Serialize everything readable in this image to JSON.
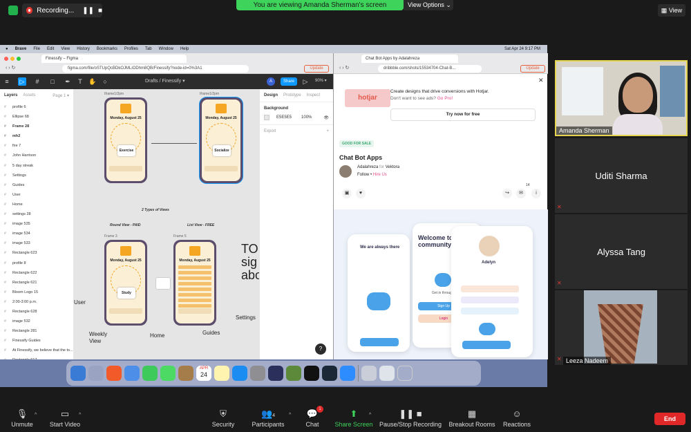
{
  "zoom": {
    "recording_label": "Recording...",
    "viewing_banner": "You are viewing Amanda Sherman's screen",
    "view_options": "View Options",
    "view_button": "View",
    "toolbar": {
      "unmute": "Unmute",
      "start_video": "Start Video",
      "security": "Security",
      "participants": "Participants",
      "participants_count": "4",
      "chat": "Chat",
      "chat_badge": "1",
      "share_screen": "Share Screen",
      "pause_stop": "Pause/Stop Recording",
      "breakout": "Breakout Rooms",
      "reactions": "Reactions",
      "end": "End"
    },
    "participants": [
      {
        "name": "Amanda Sherman",
        "active": true
      },
      {
        "name": "Uditi Sharma"
      },
      {
        "name": "Alyssa Tang"
      },
      {
        "name": "Leeza Nadeem"
      }
    ]
  },
  "mac_menu": {
    "items": [
      "Brave",
      "File",
      "Edit",
      "View",
      "History",
      "Bookmarks",
      "Profiles",
      "Tab",
      "Window",
      "Help"
    ],
    "clock": "Sat Apr 24  9:17 PM"
  },
  "figma": {
    "url": "figma.com/file/oSTUpQcBDkOJMLiODhm8QB/Finessify?node-id=0%3A1",
    "update_label": "Update",
    "breadcrumb": "Drafts  /  Finessify ▾",
    "share_label": "Share",
    "avatar_letter": "A",
    "zoom": "90% ▾",
    "layers_tab": "Layers",
    "assets_tab": "Assets",
    "page_label": "Page 1 ▾",
    "layers": [
      "profile 6",
      "Ellipse 68",
      "Frame 28",
      "mh2",
      "fire 7",
      "John Harrison",
      "5 day streak",
      "Settings",
      "Guides",
      "User",
      "Home",
      "settings 28",
      "image 535",
      "image 534",
      "image 533",
      "Rectangle 623",
      "profile 8",
      "Rectangle 622",
      "Rectangle 621",
      "Bloom Logo 15",
      "2:00-3:00 p.m.",
      "Rectangle 628",
      "image 532",
      "Rectangle 281",
      "Finessify Guides",
      "At Finessify, we believe that the to...",
      "Rectangle 617"
    ],
    "frames": {
      "frame_a": "Iframe1/2pm",
      "frame_b": "Iframe1/2pm",
      "frame_c": "Frame 3",
      "frame_d": "Frame 5",
      "date": "Monday, August 25",
      "card_1": "Exercise",
      "card_2": "Socialize",
      "card_3": "Study"
    },
    "canvas_notes": {
      "types_of_views": "2 Types of Views",
      "round_view": "Round View - PAID",
      "list_view": "List View - FREE",
      "user": "User",
      "weekly_view": "Weekly\nView",
      "home": "Home",
      "guides": "Guides",
      "settings": "Settings",
      "big_text": "TO\nsig\nabo"
    },
    "props": {
      "design_tab": "Design",
      "prototype_tab": "Prototype",
      "inspect_tab": "Inspect",
      "background_label": "Background",
      "bg_hex": "E5E5E5",
      "bg_opacity": "100%",
      "export_label": "Export"
    },
    "help": "?"
  },
  "dribbble": {
    "tab_title": "Chat Bot Apps by Adalahreza",
    "url": "dribbble.com/shots/15534704-Chat-B...",
    "update_label": "Update",
    "ad_brand": "hotjar",
    "ad_headline": "Create designs that drive conversions with Hotjar.",
    "ad_sub": "Don't want to see ads?",
    "ad_sub_link": "Go Pro!",
    "ad_button": "Try now for free",
    "badge": "GOOD FOR SALE",
    "shot_title": "Chat Bot Apps",
    "author": "Adalahreza",
    "for_label": "for",
    "team": "Vektora",
    "follow": "Follow",
    "hire": "Hire Us",
    "like_count": "14",
    "shot_texts": {
      "always_there": "We are always there",
      "welcome": "Welcome to our community",
      "get_through": "Get in through",
      "profile_name": "Adelyn",
      "sign_up": "Sign Up",
      "login": "Login"
    }
  },
  "dock": {
    "calendar_month": "APR",
    "calendar_day": "24"
  }
}
